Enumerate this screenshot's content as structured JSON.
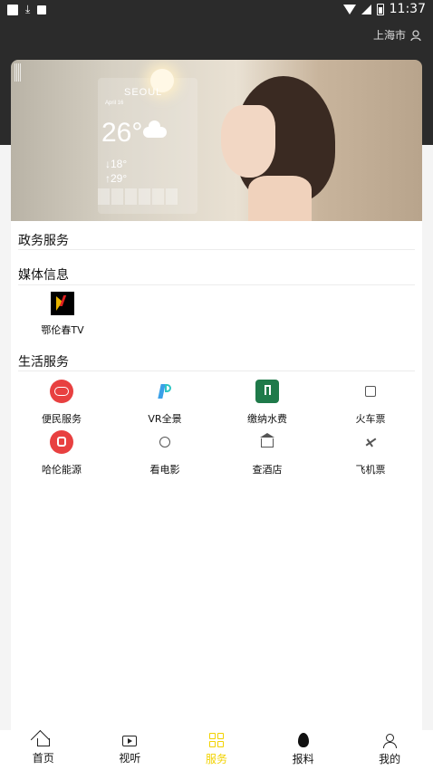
{
  "status_bar": {
    "time": "11:37"
  },
  "header": {
    "city": "上海市"
  },
  "banner": {
    "weather_city": "SEOUL",
    "weather_temp": "26°",
    "weather_date": "April 16",
    "weather_low": "↓18°",
    "weather_high": "↑29°"
  },
  "sections": {
    "gov": {
      "title": "政务服务"
    },
    "media": {
      "title": "媒体信息",
      "items": [
        {
          "label": "鄂伦春TV",
          "icon": "tv-logo-icon"
        }
      ]
    },
    "life": {
      "title": "生活服务",
      "items": [
        {
          "label": "便民服务",
          "icon": "convenience-icon"
        },
        {
          "label": "VR全景",
          "icon": "vr-icon"
        },
        {
          "label": "缴纳水费",
          "icon": "water-bill-icon"
        },
        {
          "label": "火车票",
          "icon": "train-icon"
        },
        {
          "label": "哈伦能源",
          "icon": "bus-icon"
        },
        {
          "label": "看电影",
          "icon": "film-icon"
        },
        {
          "label": "查酒店",
          "icon": "hotel-icon"
        },
        {
          "label": "飞机票",
          "icon": "plane-icon"
        }
      ]
    }
  },
  "tabs": [
    {
      "label": "首页",
      "icon": "home-icon"
    },
    {
      "label": "视听",
      "icon": "video-icon"
    },
    {
      "label": "服务",
      "icon": "grid-icon",
      "active": true
    },
    {
      "label": "报料",
      "icon": "fire-icon"
    },
    {
      "label": "我的",
      "icon": "user-icon"
    }
  ],
  "colors": {
    "accent": "#f2d200",
    "red": "#e84040",
    "green": "#1f7a4a",
    "dark": "#2b2b2b"
  }
}
